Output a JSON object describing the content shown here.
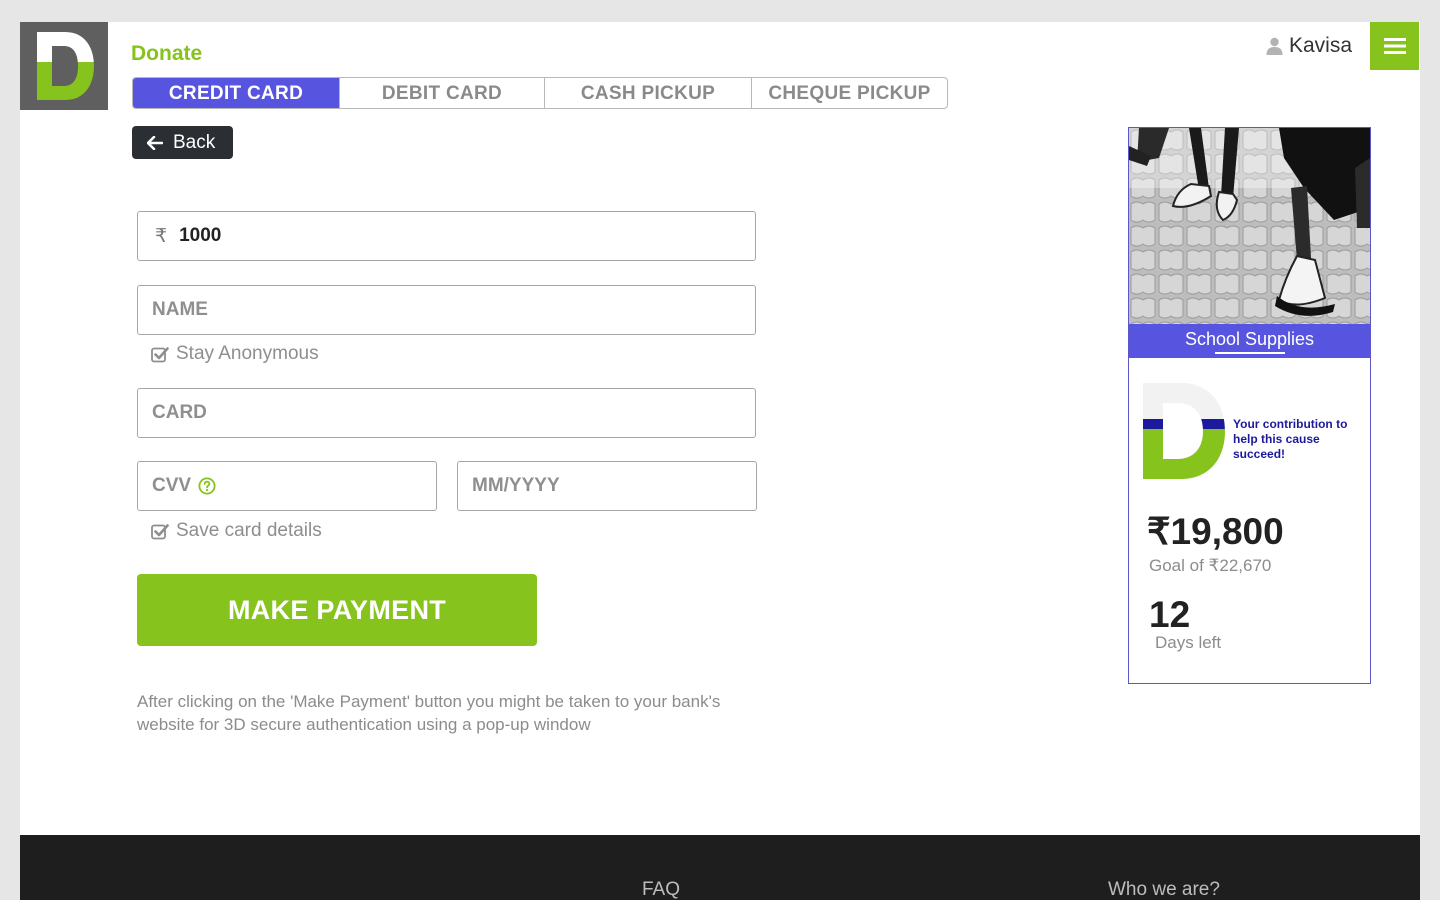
{
  "header": {
    "logo_letter": "D",
    "page_title": "Donate",
    "user_name": "Kavisa"
  },
  "tabs": [
    {
      "label": "CREDIT CARD",
      "active": true
    },
    {
      "label": "DEBIT CARD",
      "active": false
    },
    {
      "label": "CASH PICKUP",
      "active": false
    },
    {
      "label": "CHEQUE PICKUP",
      "active": false
    }
  ],
  "back_label": "Back",
  "form": {
    "currency_symbol": "₹",
    "amount_value": "1000",
    "name_placeholder": "NAME",
    "stay_anonymous_label": "Stay Anonymous",
    "stay_anonymous_checked": true,
    "card_placeholder": "CARD",
    "cvv_placeholder": "CVV",
    "expiry_placeholder": "MM/YYYY",
    "save_card_label": "Save card details",
    "save_card_checked": true,
    "pay_label": "MAKE PAYMENT",
    "note": "After clicking on the 'Make Payment' button you might be taken to your bank's website for 3D secure authentication using a pop-up window"
  },
  "campaign": {
    "title": "School Supplies",
    "message": "Your contribution to help this cause succeed!",
    "raised": "₹19,800",
    "goal_label": "Goal of",
    "goal_amount": "₹22,670",
    "days_left": "12",
    "days_label": "Days left"
  },
  "footer": {
    "links": [
      "FAQ",
      "Who we are?"
    ]
  },
  "colors": {
    "brand_green": "#86c31d",
    "accent_purple": "#5755e0",
    "dark": "#2b2e33"
  }
}
